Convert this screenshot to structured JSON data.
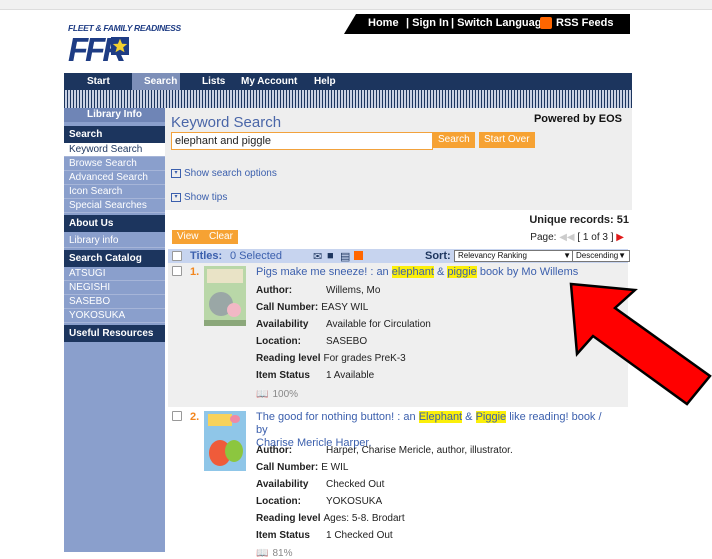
{
  "brand": {
    "logo_caption": "FLEET & FAMILY READINESS",
    "logo_letters": "FFR"
  },
  "top_nav": {
    "home": "Home",
    "sign_in": "| Sign In",
    "switch_language": "| Switch Language",
    "rss": "RSS Feeds"
  },
  "main_nav": [
    "Start",
    "Search",
    "Lists",
    "My Account",
    "Help"
  ],
  "sidebar": {
    "library_info": "Library Info",
    "search_header": "Search",
    "search_items": [
      "Keyword Search",
      "Browse Search",
      "Advanced Search",
      "Icon Search",
      "Special Searches"
    ],
    "about_header": "About Us",
    "about_items": [
      "Library info"
    ],
    "catalog_header": "Search Catalog",
    "catalog_items": [
      "ATSUGI",
      "NEGISHI",
      "SASEBO",
      "YOKOSUKA"
    ],
    "resources_header": "Useful Resources"
  },
  "search": {
    "title": "Keyword Search",
    "powered_by": "Powered by EOS",
    "query": "elephant and piggle",
    "search_button": "Search",
    "start_over_button": "Start Over",
    "show_search_options": "Show search options",
    "show_tips": "Show tips"
  },
  "results_meta": {
    "unique_records": "Unique records: 51",
    "view_button": "View",
    "clear_button": "Clear",
    "page_label": "Page:",
    "page_info": "[ 1 of 3 ]",
    "titles_label": "Titles:",
    "selected": "0 Selected",
    "sort_label": "Sort:",
    "sort_by": "Relevancy Ranking",
    "sort_order": "Descending"
  },
  "results": [
    {
      "number": "1.",
      "title_pre": "Pigs make me sneeze! : an ",
      "hl1": "elephant",
      "mid": " & ",
      "hl2": "piggie",
      "title_post": " book by Mo Willems",
      "title_line2": "",
      "author": "Willems, Mo",
      "call_number": "EASY WIL",
      "availability": "Available for Circulation",
      "location": "SASEBO",
      "reading_level": "For grades PreK-3",
      "item_status": "1 Available",
      "relevance": "100%"
    },
    {
      "number": "2.",
      "title_pre": "The good for nothing button! : an ",
      "hl1": "Elephant",
      "mid": " & ",
      "hl2": "Piggie",
      "title_post": " like reading! book / by",
      "title_line2": "Charise Mericle Harper.",
      "author": "Harper, Charise Mericle, author, illustrator.",
      "call_number": "E WIL",
      "availability": "Checked Out",
      "location": "YOKOSUKA",
      "reading_level": "Ages: 5-8. Brodart",
      "item_status": "1 Checked Out",
      "relevance": "81%"
    }
  ],
  "labels": {
    "author": "Author:",
    "call_number": "Call Number:",
    "availability": "Availability",
    "location": "Location:",
    "reading_level": "Reading level",
    "item_status": "Item Status"
  },
  "colors": {
    "nav": "#1c355e",
    "sidebar": "#8a9fcc",
    "accent": "#f6a233",
    "link": "#3b5fad",
    "highlight": "#fbef0a",
    "arrow": "#ff0000"
  }
}
